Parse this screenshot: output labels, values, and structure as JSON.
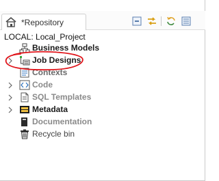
{
  "tab": {
    "title": "*Repository",
    "icon": "repository-home-icon"
  },
  "toolbar": {
    "buttons": [
      {
        "icon": "collapse-all-icon"
      },
      {
        "icon": "link-with-editor-icon"
      },
      {
        "icon": "refresh-icon"
      },
      {
        "icon": "view-menu-icon"
      }
    ]
  },
  "location": {
    "label": "LOCAL: Local_Project"
  },
  "tree": {
    "items": [
      {
        "label": "Business Models",
        "icon": "business-models-icon",
        "expandable": false,
        "style": "bold"
      },
      {
        "label": "Job Designs",
        "icon": "job-designs-icon",
        "expandable": true,
        "style": "bold"
      },
      {
        "label": "Contexts",
        "icon": "contexts-icon",
        "expandable": false,
        "style": "bold"
      },
      {
        "label": "Code",
        "icon": "code-icon",
        "expandable": true,
        "style": "gray"
      },
      {
        "label": "SQL Templates",
        "icon": "sql-templates-icon",
        "expandable": true,
        "style": "gray"
      },
      {
        "label": "Metadata",
        "icon": "metadata-icon",
        "expandable": true,
        "style": "bold"
      },
      {
        "label": "Documentation",
        "icon": "documentation-icon",
        "expandable": false,
        "style": "gray"
      },
      {
        "label": "Recycle bin",
        "icon": "recycle-bin-icon",
        "expandable": false,
        "style": "dark"
      }
    ]
  },
  "annotation": {
    "color": "#e0141a",
    "target": "Job Designs"
  },
  "colors": {
    "folder": "#c9a23a",
    "accent": "#2a6fbd",
    "annotation": "#e0141a"
  }
}
